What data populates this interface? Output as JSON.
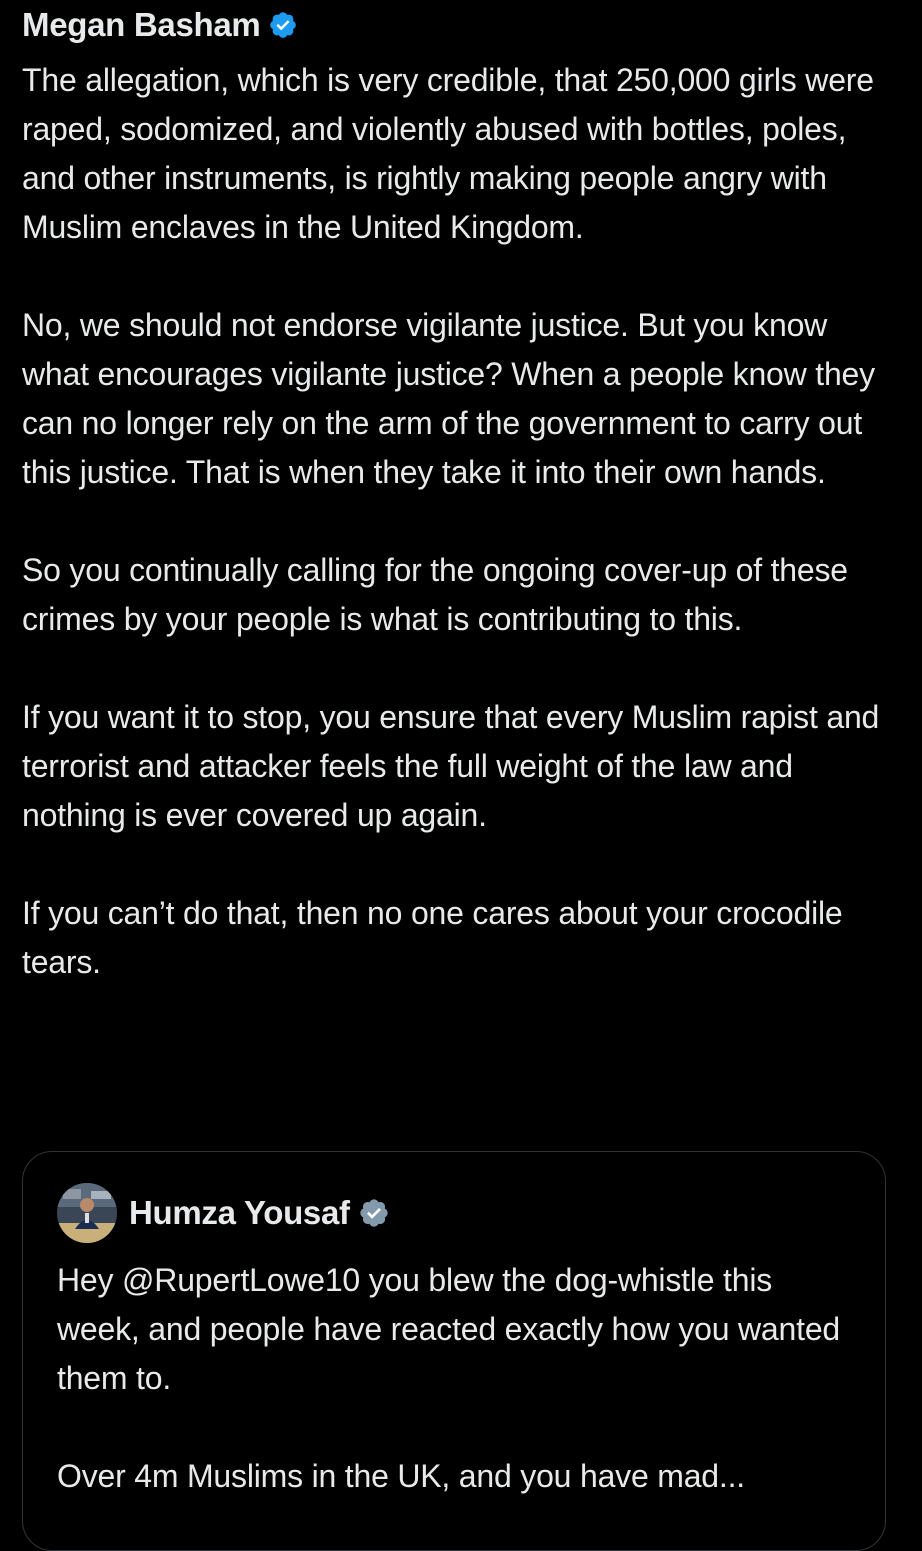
{
  "post": {
    "author_name": "Megan Basham",
    "verified_color": "#1d9bf0",
    "text": "The allegation, which is very credible, that 250,000 girls were raped, sodomized, and violently abused with bottles, poles, and other instruments, is rightly making people angry with Muslim enclaves in the United Kingdom.\n\nNo, we should not endorse vigilante justice. But you know what encourages vigilante justice? When a people know they can no longer rely on the arm of the government to carry out this justice. That is when they take it into their own hands.\n\nSo you continually calling for the ongoing cover-up of these crimes by your people is what is contributing to this.\n\nIf you want it to stop, you ensure that every Muslim rapist and terrorist and attacker feels the full weight of the law and nothing is ever covered up again.\n\nIf you can’t do that, then no one cares about your crocodile tears."
  },
  "quoted_post": {
    "author_name": "Humza Yousaf",
    "verified_color": "#829aab",
    "text": "Hey @RupertLowe10 you blew the dog-whistle this week, and people have reacted exactly how you wanted them to.\n\nOver 4m Muslims in the UK, and you have mad..."
  },
  "icons": {
    "post_verified": "verified-badge-icon",
    "quote_verified": "government-verified-badge-icon",
    "quote_avatar": "avatar-image"
  }
}
